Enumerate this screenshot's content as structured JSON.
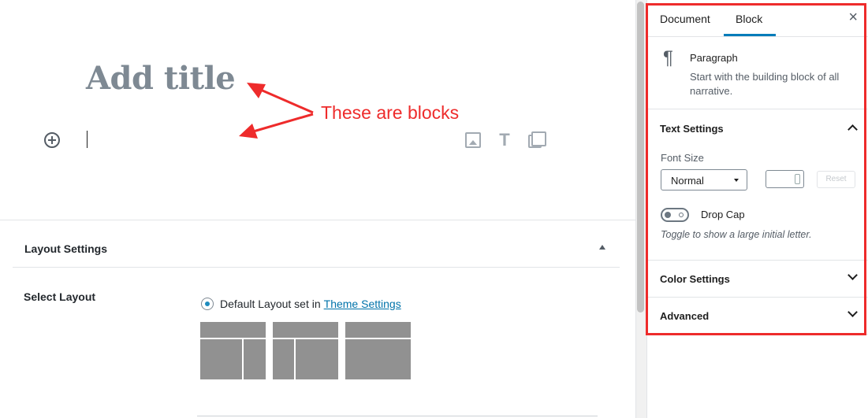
{
  "editor": {
    "title_placeholder": "Add title",
    "annotation": "These are blocks",
    "quick_inserter": {
      "icons": [
        "image-icon",
        "heading-icon",
        "gallery-icon"
      ]
    },
    "meta_box": {
      "title": "Layout Settings",
      "field_label": "Select Layout",
      "radio_text": "Default Layout set in",
      "radio_link": "Theme Settings",
      "layout_options": [
        "layout-left-sidebar",
        "layout-right-sidebar",
        "layout-full-width"
      ]
    }
  },
  "sidebar": {
    "tabs": {
      "document": "Document",
      "block": "Block"
    },
    "active_tab": "Block",
    "close_label": "×",
    "block_card": {
      "icon": "¶",
      "title": "Paragraph",
      "description": "Start with the building block of all narrative."
    },
    "text_settings": {
      "title": "Text Settings",
      "font_size_label": "Font Size",
      "font_size_value": "Normal",
      "custom_size_value": "",
      "reset_label": "Reset",
      "drop_cap_label": "Drop Cap",
      "drop_cap_enabled": false,
      "drop_cap_help": "Toggle to show a large initial letter."
    },
    "color_settings": {
      "title": "Color Settings"
    },
    "advanced": {
      "title": "Advanced"
    }
  },
  "colors": {
    "annotation_red": "#ee2b2b",
    "accent_blue": "#007cba",
    "link_blue": "#0073aa",
    "title_gray": "#7e8993",
    "layout_gray": "#919191"
  }
}
